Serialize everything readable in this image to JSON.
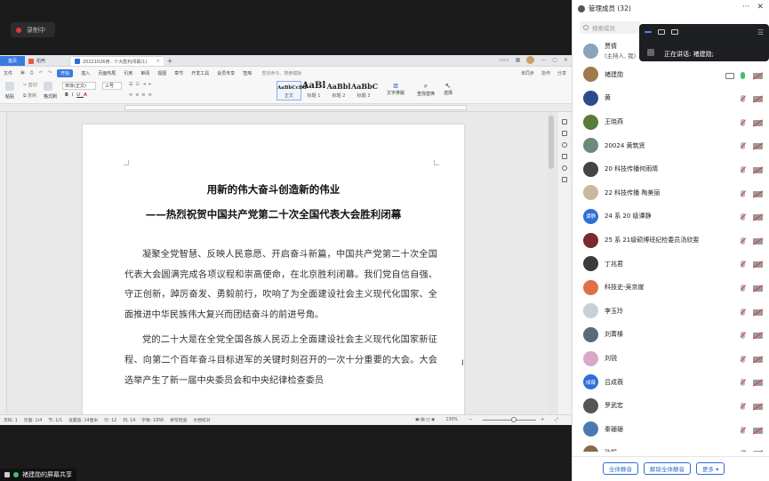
{
  "recording": {
    "label": "录制中"
  },
  "share": {
    "label": "褚建勋的屏幕共享"
  },
  "wps": {
    "tabs": [
      {
        "label": "首页"
      },
      {
        "label": "稻壳"
      },
      {
        "label": "20221026用...十大胜利闭幕(1)"
      },
      {
        "label": "+"
      }
    ],
    "menu": [
      "文件",
      "开始",
      "插入",
      "页面布局",
      "引用",
      "审阅",
      "视图",
      "章节",
      "开发工具",
      "会员专享",
      "智库"
    ],
    "active_menu": "开始",
    "search": "查找命令、搜索模板",
    "menu_right": [
      "未同步",
      "协作",
      "分享"
    ],
    "ribbon": {
      "paste": "粘贴",
      "cut": "剪切",
      "copy": "复制",
      "format_painter": "格式刷",
      "font_name": "宋体(正文)",
      "font_size": "三号",
      "styles": [
        {
          "sample": "AaBbCcDd",
          "name": "正文"
        },
        {
          "sample": "AaBl",
          "name": "标题 1"
        },
        {
          "sample": "AaBbl",
          "name": "标题 2"
        },
        {
          "sample": "AaBbC",
          "name": "标题 3"
        }
      ],
      "text_layout": "文字排版",
      "find_replace": "查找替换",
      "select": "选择"
    },
    "status": {
      "page_num": "页码: 1",
      "page": "页面: 1/4",
      "section": "节: 1/1",
      "settings": "设置值: 14厘米",
      "row": "行: 12",
      "col": "列: 14",
      "words": "字数: 1956",
      "spell": "拼写检查",
      "proof": "文档校对",
      "zoom": "130%"
    }
  },
  "document": {
    "title": "用新的伟大奋斗创造新的伟业",
    "subtitle": "——热烈祝贺中国共产党第二十次全国代表大会胜利闭幕",
    "paragraphs": [
      "凝聚全党智慧、反映人民意愿、开启奋斗新篇，中国共产党第二十次全国代表大会圆满完成各项议程和崇高使命，在北京胜利闭幕。我们党自信自强、守正创新，踔厉奋发、勇毅前行，吹响了为全面建设社会主义现代化国家、全面推进中华民族伟大复兴而团结奋斗的前进号角。",
      "党的二十大是在全党全国各族人民迈上全面建设社会主义现代化国家新征程、向第二个百年奋斗目标进军的关键时刻召开的一次十分重要的大会。大会选举产生了新一届中央委员会和中央纪律检查委员"
    ]
  },
  "panel": {
    "title": "管理成员 (32)",
    "search_placeholder": "搜索成员",
    "speaking": "正在讲话: 褚建勋;",
    "members": [
      {
        "name": "贾倩",
        "sub": "(主持人, 我)",
        "color": "#8aa3b8",
        "mic": "muted",
        "cam": true,
        "screen": false,
        "initials": ""
      },
      {
        "name": "褚建勋",
        "sub": "",
        "color": "#a07a4a",
        "mic": "on",
        "cam": true,
        "screen": true,
        "initials": ""
      },
      {
        "name": "黄",
        "sub": "",
        "color": "#2b4b8a",
        "mic": "muted",
        "cam": true,
        "screen": false,
        "initials": ""
      },
      {
        "name": "王晓燕",
        "sub": "",
        "color": "#5a7a3a",
        "mic": "muted",
        "cam": true,
        "screen": false,
        "initials": ""
      },
      {
        "name": "20024 黄筑贤",
        "sub": "",
        "color": "#6b8a7a",
        "mic": "muted",
        "cam": true,
        "screen": false,
        "initials": ""
      },
      {
        "name": "20 科技传播何雨晴",
        "sub": "",
        "color": "#444444",
        "mic": "muted",
        "cam": true,
        "screen": false,
        "initials": ""
      },
      {
        "name": "22 科技传播 陶美丽",
        "sub": "",
        "color": "#c9b89a",
        "mic": "muted",
        "cam": true,
        "screen": false,
        "initials": ""
      },
      {
        "name": "24 系 20 级谭静",
        "sub": "",
        "color": "#2f6fd6",
        "mic": "muted",
        "cam": true,
        "screen": false,
        "initials": "谭静"
      },
      {
        "name": "25 系 21级硕博班纪检委员汤欣雯",
        "sub": "",
        "color": "#7a2a2a",
        "mic": "muted",
        "cam": true,
        "screen": false,
        "initials": ""
      },
      {
        "name": "丁兆君",
        "sub": "",
        "color": "#3a3a3a",
        "mic": "muted",
        "cam": true,
        "screen": false,
        "initials": ""
      },
      {
        "name": "科技史-吴京崖",
        "sub": "",
        "color": "#e0704a",
        "mic": "muted",
        "cam": true,
        "screen": false,
        "initials": ""
      },
      {
        "name": "李玉玲",
        "sub": "",
        "color": "#c8cfd6",
        "mic": "muted",
        "cam": true,
        "screen": false,
        "initials": ""
      },
      {
        "name": "刘菁榛",
        "sub": "",
        "color": "#5a6a7a",
        "mic": "muted",
        "cam": true,
        "screen": false,
        "initials": ""
      },
      {
        "name": "刘锐",
        "sub": "",
        "color": "#d8a8c8",
        "mic": "muted",
        "cam": true,
        "screen": false,
        "initials": ""
      },
      {
        "name": "吕成薇",
        "sub": "",
        "color": "#2f6fd6",
        "mic": "muted",
        "cam": true,
        "screen": false,
        "initials": "成薇"
      },
      {
        "name": "罗武宏",
        "sub": "",
        "color": "#555555",
        "mic": "muted",
        "cam": true,
        "screen": false,
        "initials": ""
      },
      {
        "name": "秦珊珊",
        "sub": "",
        "color": "#4a7ab0",
        "mic": "muted",
        "cam": true,
        "screen": false,
        "initials": ""
      },
      {
        "name": "孙娟",
        "sub": "",
        "color": "#8a6a4a",
        "mic": "muted",
        "cam": true,
        "screen": false,
        "initials": ""
      }
    ],
    "footer": {
      "mute_all": "全体静音",
      "unmute_all": "解除全体静音",
      "more": "更多 ▾"
    }
  }
}
